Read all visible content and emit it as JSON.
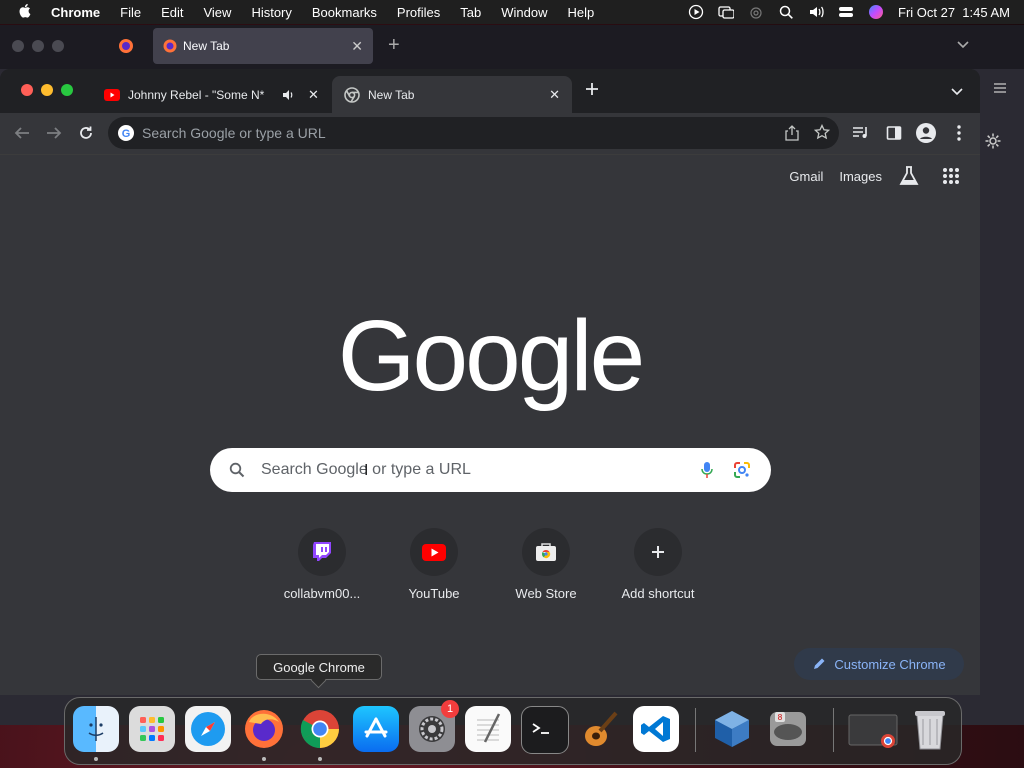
{
  "menubar": {
    "apple": "",
    "app_name": "Chrome",
    "items": [
      "File",
      "Edit",
      "View",
      "History",
      "Bookmarks",
      "Profiles",
      "Tab",
      "Window",
      "Help"
    ],
    "clock": "Fri Oct 27  1:45 AM"
  },
  "firefox_window": {
    "tab_title": "New Tab"
  },
  "chrome": {
    "tabs": [
      {
        "title": "Johnny Rebel - \"Some N*"
      },
      {
        "title": "New Tab"
      }
    ],
    "omnibox_placeholder": "Search Google or type a URL",
    "ntp": {
      "gmail": "Gmail",
      "images": "Images",
      "logo": "Google",
      "search_placeholder": "Search Google or type a URL",
      "shortcuts": [
        {
          "label": "collabvm00...",
          "icon": "twitch-icon"
        },
        {
          "label": "YouTube",
          "icon": "youtube-icon"
        },
        {
          "label": "Web Store",
          "icon": "webstore-icon"
        },
        {
          "label": "Add shortcut",
          "icon": "plus-icon"
        }
      ],
      "customize": "Customize Chrome"
    }
  },
  "tooltip": "Google Chrome",
  "dock": {
    "items": [
      "finder-icon",
      "launchpad-icon",
      "safari-icon",
      "firefox-icon",
      "chrome-icon",
      "app-store-icon",
      "system-settings-icon",
      "textedit-icon",
      "terminal-icon",
      "garageband-icon",
      "vscode-icon",
      "virtualbox-icon",
      "vm-app-icon",
      "minimized-chrome-window",
      "trash-icon"
    ],
    "settings_badge": "1"
  },
  "colors": {
    "chrome_bg": "#202124",
    "ntp_bg": "#35363a",
    "accent": "#8ab4f8"
  }
}
